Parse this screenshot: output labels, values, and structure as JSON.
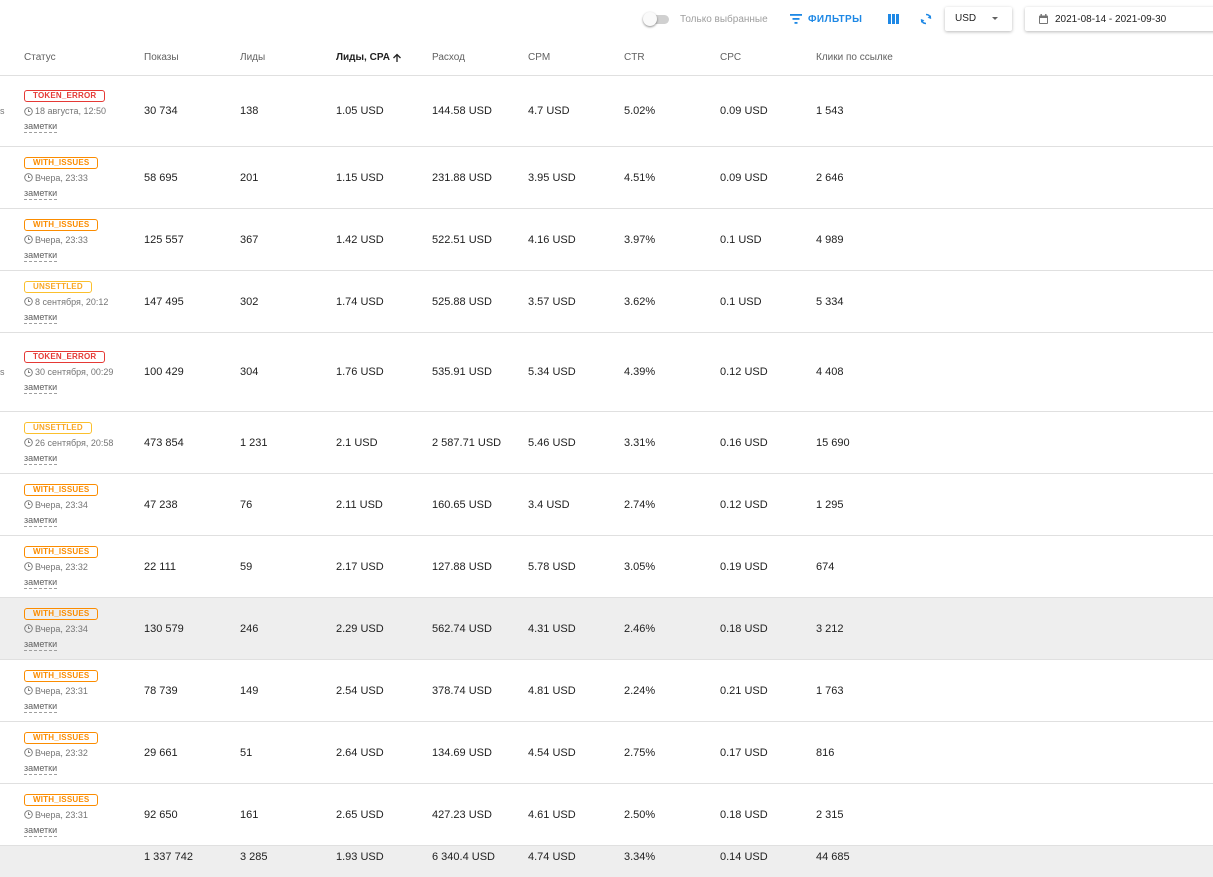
{
  "toolbar": {
    "only_selected_label": "Только выбранные",
    "filters_label": "ФИЛЬТРЫ",
    "currency": "USD",
    "date_range": "2021-08-14 - 2021-09-30",
    "accent_color": "#1e88e5"
  },
  "columns": {
    "status": "Статус",
    "impressions": "Показы",
    "leads": "Лиды",
    "cpa": "Лиды, CPA",
    "spend": "Расход",
    "cpm": "CPM",
    "ctr": "CTR",
    "cpc": "CPC",
    "link_clicks": "Клики по ссылке"
  },
  "rows": [
    {
      "status": "TOKEN_ERROR",
      "kind": "error",
      "time": "18 августа, 12:50",
      "notes": "заметки",
      "edge": "s",
      "impressions": "30 734",
      "leads": "138",
      "cpa": "1.05 USD",
      "spend": "144.58 USD",
      "cpm": "4.7 USD",
      "ctr": "5.02%",
      "cpc": "0.09 USD",
      "link_clicks": "1 543"
    },
    {
      "status": "WITH_ISSUES",
      "kind": "issues",
      "time": "Вчера, 23:33",
      "notes": "заметки",
      "impressions": "58 695",
      "leads": "201",
      "cpa": "1.15 USD",
      "spend": "231.88 USD",
      "cpm": "3.95 USD",
      "ctr": "4.51%",
      "cpc": "0.09 USD",
      "link_clicks": "2 646"
    },
    {
      "status": "WITH_ISSUES",
      "kind": "issues",
      "time": "Вчера, 23:33",
      "notes": "заметки",
      "impressions": "125 557",
      "leads": "367",
      "cpa": "1.42 USD",
      "spend": "522.51 USD",
      "cpm": "4.16 USD",
      "ctr": "3.97%",
      "cpc": "0.1 USD",
      "link_clicks": "4 989"
    },
    {
      "status": "UNSETTLED",
      "kind": "unsettled",
      "time": "8 сентября, 20:12",
      "notes": "заметки",
      "impressions": "147 495",
      "leads": "302",
      "cpa": "1.74 USD",
      "spend": "525.88 USD",
      "cpm": "3.57 USD",
      "ctr": "3.62%",
      "cpc": "0.1 USD",
      "link_clicks": "5 334"
    },
    {
      "status": "TOKEN_ERROR",
      "kind": "error",
      "time": "30 сентября, 00:29",
      "notes": "заметки",
      "edge": "s",
      "impressions": "100 429",
      "leads": "304",
      "cpa": "1.76 USD",
      "spend": "535.91 USD",
      "cpm": "5.34 USD",
      "ctr": "4.39%",
      "cpc": "0.12 USD",
      "link_clicks": "4 408"
    },
    {
      "status": "UNSETTLED",
      "kind": "unsettled",
      "time": "26 сентября, 20:58",
      "notes": "заметки",
      "impressions": "473 854",
      "leads": "1 231",
      "cpa": "2.1 USD",
      "spend": "2 587.71 USD",
      "cpm": "5.46 USD",
      "ctr": "3.31%",
      "cpc": "0.16 USD",
      "link_clicks": "15 690"
    },
    {
      "status": "WITH_ISSUES",
      "kind": "issues",
      "time": "Вчера, 23:34",
      "notes": "заметки",
      "impressions": "47 238",
      "leads": "76",
      "cpa": "2.11 USD",
      "spend": "160.65 USD",
      "cpm": "3.4 USD",
      "ctr": "2.74%",
      "cpc": "0.12 USD",
      "link_clicks": "1 295"
    },
    {
      "status": "WITH_ISSUES",
      "kind": "issues",
      "time": "Вчера, 23:32",
      "notes": "заметки",
      "impressions": "22 111",
      "leads": "59",
      "cpa": "2.17 USD",
      "spend": "127.88 USD",
      "cpm": "5.78 USD",
      "ctr": "3.05%",
      "cpc": "0.19 USD",
      "link_clicks": "674"
    },
    {
      "status": "WITH_ISSUES",
      "kind": "issues",
      "time": "Вчера, 23:34",
      "notes": "заметки",
      "highlighted": true,
      "impressions": "130 579",
      "leads": "246",
      "cpa": "2.29 USD",
      "spend": "562.74 USD",
      "cpm": "4.31 USD",
      "ctr": "2.46%",
      "cpc": "0.18 USD",
      "link_clicks": "3 212"
    },
    {
      "status": "WITH_ISSUES",
      "kind": "issues",
      "time": "Вчера, 23:31",
      "notes": "заметки",
      "impressions": "78 739",
      "leads": "149",
      "cpa": "2.54 USD",
      "spend": "378.74 USD",
      "cpm": "4.81 USD",
      "ctr": "2.24%",
      "cpc": "0.21 USD",
      "link_clicks": "1 763"
    },
    {
      "status": "WITH_ISSUES",
      "kind": "issues",
      "time": "Вчера, 23:32",
      "notes": "заметки",
      "impressions": "29 661",
      "leads": "51",
      "cpa": "2.64 USD",
      "spend": "134.69 USD",
      "cpm": "4.54 USD",
      "ctr": "2.75%",
      "cpc": "0.17 USD",
      "link_clicks": "816"
    },
    {
      "status": "WITH_ISSUES",
      "kind": "issues",
      "time": "Вчера, 23:31",
      "notes": "заметки",
      "impressions": "92 650",
      "leads": "161",
      "cpa": "2.65 USD",
      "spend": "427.23 USD",
      "cpm": "4.61 USD",
      "ctr": "2.50%",
      "cpc": "0.18 USD",
      "link_clicks": "2 315"
    }
  ],
  "totals": {
    "impressions": "1 337 742",
    "leads": "3 285",
    "cpa": "1.93 USD",
    "spend": "6 340.4 USD",
    "cpm": "4.74 USD",
    "ctr": "3.34%",
    "cpc": "0.14 USD",
    "link_clicks": "44 685"
  },
  "status_colors": {
    "error": "#e53935",
    "issues": "#fb8c00",
    "unsettled": "#fbc02d"
  }
}
